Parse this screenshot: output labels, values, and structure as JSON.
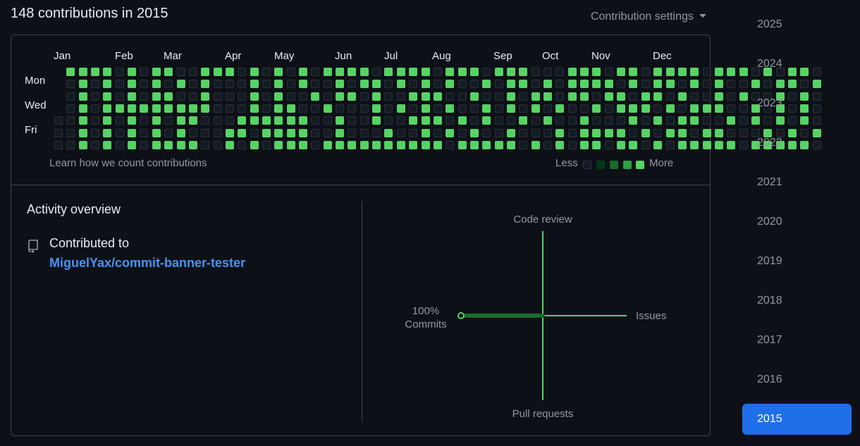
{
  "header": {
    "title": "148 contributions in 2015",
    "settings_label": "Contribution settings"
  },
  "calendar": {
    "months": [
      "Jan",
      "Feb",
      "Mar",
      "Apr",
      "May",
      "Jun",
      "Jul",
      "Aug",
      "Sep",
      "Oct",
      "Nov",
      "Dec"
    ],
    "day_labels": [
      "Mon",
      "Wed",
      "Fri"
    ],
    "learn_link": "Learn how we count contributions",
    "legend_less": "Less",
    "legend_more": "More",
    "colors": {
      "level0": "#151b23",
      "level1": "#033a16",
      "level2": "#196c2e",
      "level3": "#2ea043",
      "level4": "#56d364"
    },
    "weeks": [
      "    000",
      "4000000",
      "4444444",
      "4000000",
      "0000000",
      "4444444",
      "0000000",
      "0000000",
      "4444444",
      "0040000",
      "4444444",
      "0000000",
      "4444444",
      "0000000",
      "0000000",
      "4444444",
      "4444444",
      "0000000",
      "4000000",
      "0000000",
      "4000000",
      "0444444",
      "0000000",
      "4000000",
      "0040000",
      "0000000",
      "4000000",
      "0000000",
      "0000000",
      "4000000",
      "0000000",
      "0000000",
      "0000000",
      "4000000",
      "0000000",
      "0000000",
      "4040000",
      "0040000",
      "0000000",
      "0000000",
      "4000000",
      "0000000",
      "0000000",
      "4000000",
      "0000000",
      "4000000",
      "4000000",
      "0000000",
      "4000000",
      "0000000",
      "4000000",
      "0000000",
      "4000000",
      "0000000",
      "0000000",
      "0000000",
      "4444444",
      "0000000",
      "0000000",
      "0000000",
      "0000000",
      "0000000",
      "0000000",
      "4000000",
      "4000000",
      "0000000",
      "0000000",
      "0000000",
      "0000000",
      "0000000",
      "0000000",
      "0000000",
      "0000000",
      "0000000",
      "0000000",
      "0000000",
      "0000000",
      "0000000",
      "0000000",
      "0000000",
      "0000000",
      "0000000",
      "0000000",
      "0000000"
    ],
    "rows": [
      " 44440404400444040404044440444404440444000444044044440444040440",
      " 04040404040400040404004044040404004044040444404044040400404404",
      " 04040404400400040400404404004440040040440440440440400404004040",
      " 04044444444400040440040004040404004040404004044404044400404040",
      "004040404044000444444004004004440404004040040004040440040404040",
      "004040404040004404444004000400404040040004044440404404400040404",
      "004040404444004040444044444444440444440404044044040444440444440"
    ]
  },
  "activity": {
    "heading": "Activity overview",
    "contributed_to_label": "Contributed to",
    "repo": "MiguelYax/commit-banner-tester",
    "radar": {
      "top_label": "Code review",
      "right_label": "Issues",
      "bottom_label": "Pull requests",
      "left_percent": "100%",
      "left_label": "Commits",
      "values": {
        "code_review": 0,
        "issues": 0,
        "pull_requests": 0,
        "commits": 100
      },
      "line_color": "#56d364",
      "fill_color": "#196c2e"
    }
  },
  "years": {
    "items": [
      "2025",
      "2024",
      "2023",
      "2022",
      "2021",
      "2020",
      "2019",
      "2018",
      "2017",
      "2016",
      "2015"
    ],
    "selected": "2015",
    "selected_color": "#1f6feb"
  }
}
